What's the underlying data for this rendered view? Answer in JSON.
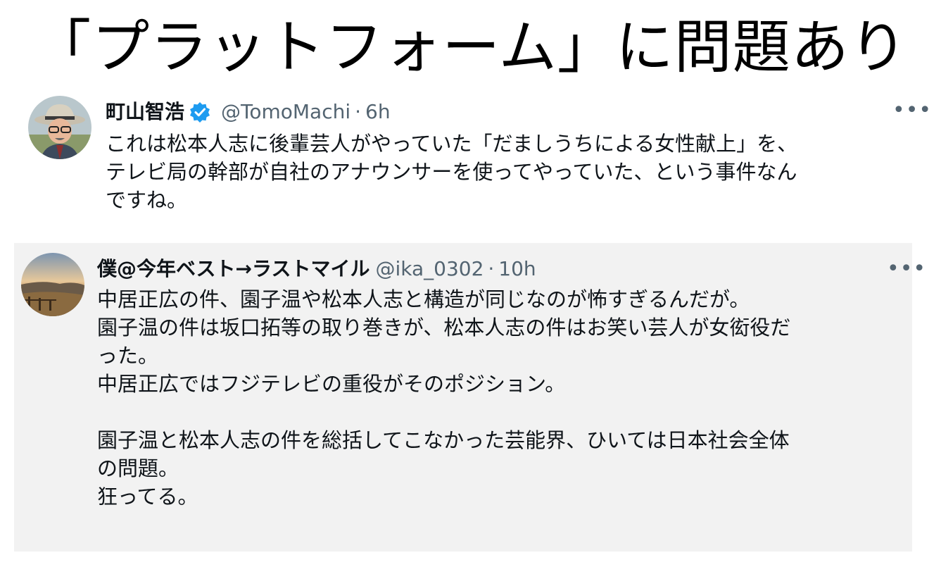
{
  "headline": "「プラットフォーム」に問題あり",
  "tweet1": {
    "name": "町山智浩",
    "handle": "@TomoMachi",
    "separator": "·",
    "time": "6h",
    "more": "•••",
    "lines": [
      "これは松本人志に後輩芸人がやっていた「だましうちによる女性献上」を、",
      "テレビ局の幹部が自社のアナウンサーを使ってやっていた、という事件なん",
      "ですね。"
    ]
  },
  "tweet2": {
    "name": "僕@今年ベスト→ラストマイル",
    "handle": "@ika_0302",
    "separator": "·",
    "time": "10h",
    "more": "•••",
    "lines": [
      "中居正広の件、園子温や松本人志と構造が同じなのが怖すぎるんだが。",
      "園子温の件は坂口拓等の取り巻きが、松本人志の件はお笑い芸人が女衒役だ",
      "った。",
      "中居正広ではフジテレビの重役がそのポジション。",
      "",
      "園子温と松本人志の件を総括してこなかった芸能界、ひいては日本社会全体",
      "の問題。",
      "狂ってる。"
    ]
  },
  "colors": {
    "verified": "#1d9bf0",
    "muted": "#536471",
    "quote_bg": "#f2f2f2"
  },
  "icons": {
    "verified": "verified-badge-icon",
    "more": "more-options-icon"
  }
}
